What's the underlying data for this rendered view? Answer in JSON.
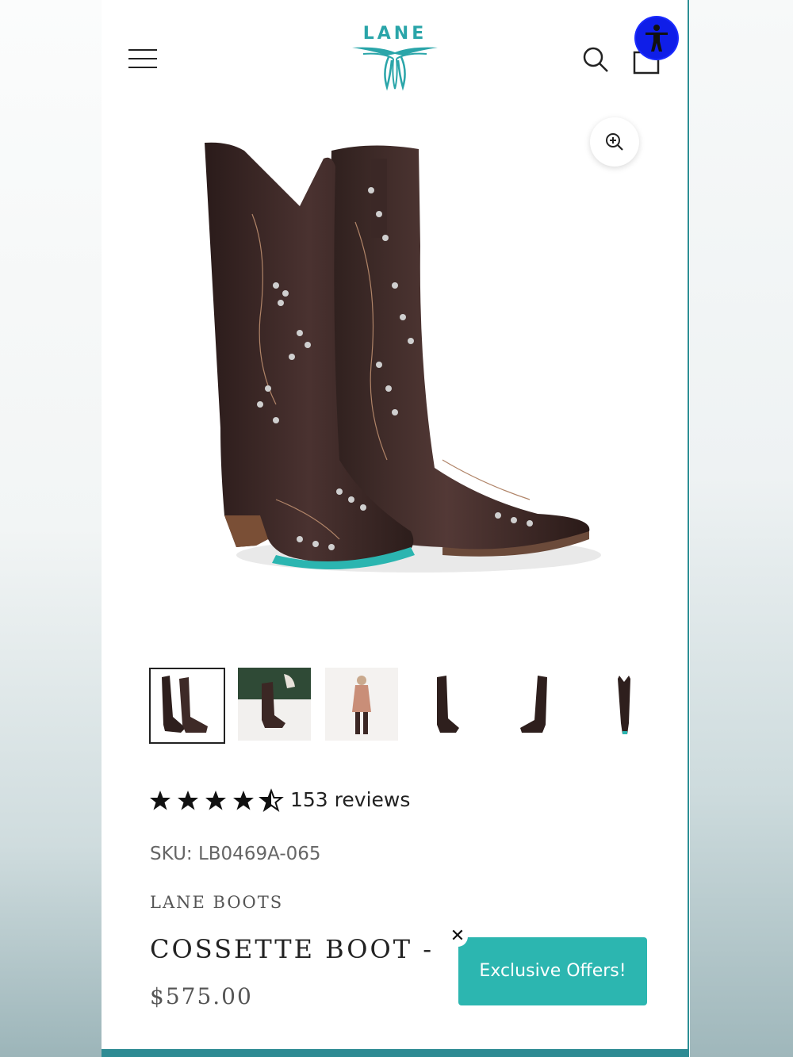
{
  "header": {
    "logo_text": "LANE",
    "menu_icon": "hamburger-menu-icon",
    "search_icon": "search-icon",
    "cart_icon": "shopping-bag-icon",
    "accessibility_icon": "accessibility-person-icon",
    "accessibility_color": "#0f1ee8",
    "brand_color": "#2aa5a9"
  },
  "gallery": {
    "zoom_icon": "zoom-in-icon",
    "thumbnails": [
      {
        "name": "thumb-pair-boots",
        "selected": true
      },
      {
        "name": "thumb-lifestyle-green"
      },
      {
        "name": "thumb-lifestyle-model"
      },
      {
        "name": "thumb-side-view"
      },
      {
        "name": "thumb-inner-side-view"
      },
      {
        "name": "thumb-front-view"
      }
    ]
  },
  "product": {
    "rating": 4.5,
    "reviews_label": "153 reviews",
    "sku_label": "SKU: LB0469A-065",
    "brand": "LANE BOOTS",
    "title": "COSSETTE BOOT -",
    "price": "$575.00"
  },
  "popup": {
    "offers_label": "Exclusive Offers!",
    "close_symbol": "✕",
    "color": "#2cb6b0"
  }
}
